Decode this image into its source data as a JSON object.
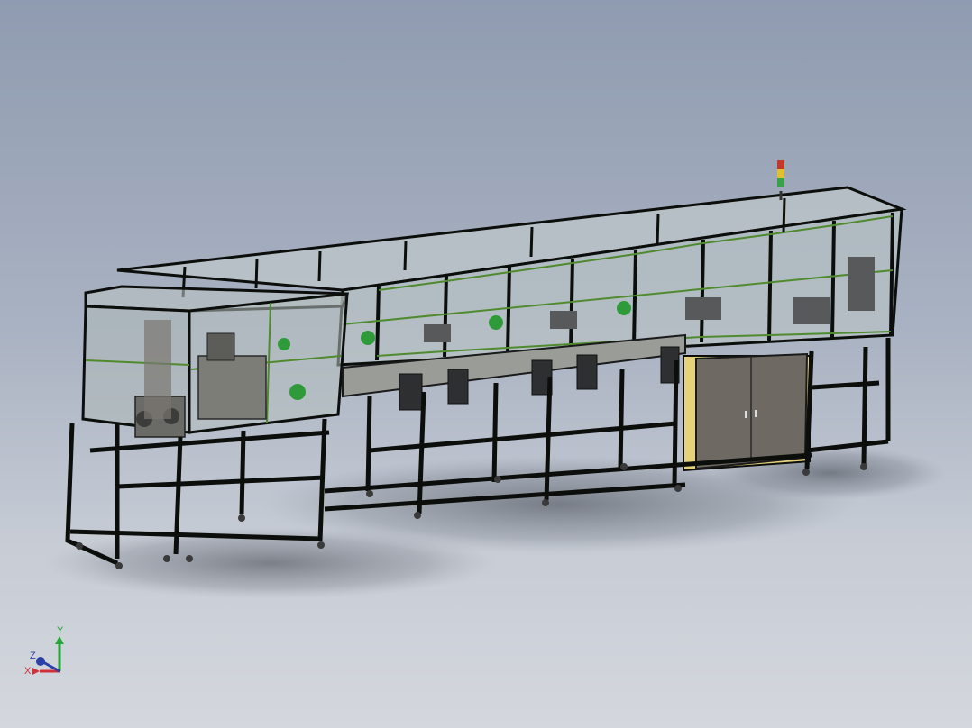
{
  "viewport": {
    "background_top": "#8f9bb0",
    "background_bottom": "#d4d7dd"
  },
  "model": {
    "frame_color": "#0c0e0c",
    "trim_color": "#4f8a2e",
    "glass_color": "#c9d3cf",
    "cabinet_color": "#6e6a63",
    "cabinet_edge_color": "#e6d27a",
    "accent_green": "#2f9a3a",
    "stack_light_colors": [
      "#c0392b",
      "#e0c030",
      "#3aa04a"
    ]
  },
  "triad": {
    "x_label": "X",
    "y_label": "Y",
    "z_label": "Z",
    "x_color": "#d0303a",
    "y_color": "#23a838",
    "z_color": "#2b3fa8"
  }
}
